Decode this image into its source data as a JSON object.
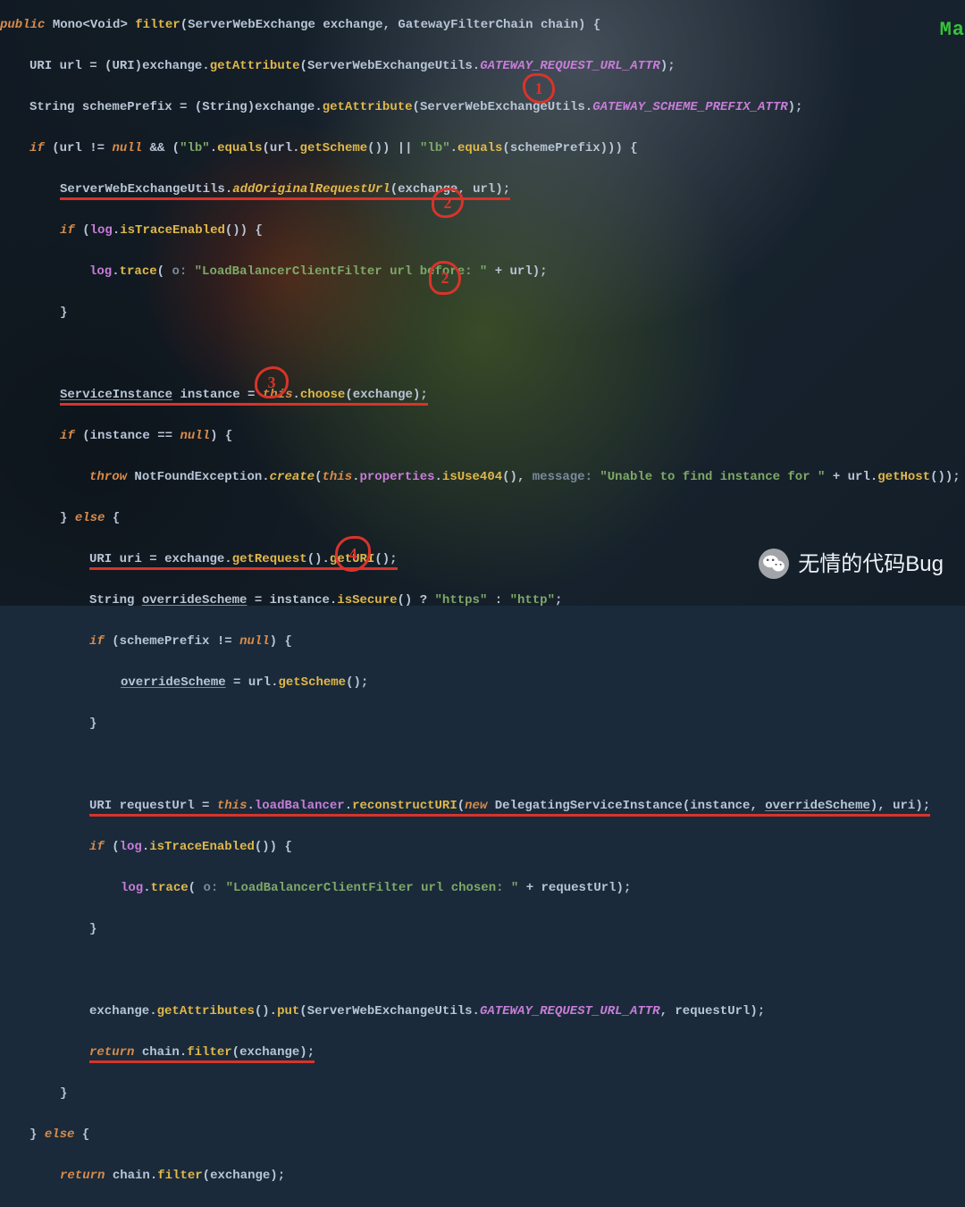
{
  "corner_label": "Ma",
  "watermark": "无情的代码Bug",
  "annotations": {
    "a1": "1",
    "a2": "2",
    "a2b": "2",
    "a3": "3",
    "a4": "4"
  },
  "tokens": {
    "public": "public",
    "Mono": "Mono",
    "Void": "Void",
    "filter": "filter",
    "ServerWebExchange": "ServerWebExchange",
    "exchange": "exchange",
    "GatewayFilterChain": "GatewayFilterChain",
    "chain": "chain",
    "URI": "URI",
    "url": "url",
    "getAttribute": "getAttribute",
    "ServerWebExchangeUtils": "ServerWebExchangeUtils",
    "GATEWAY_REQUEST_URL_ATTR": "GATEWAY_REQUEST_URL_ATTR",
    "String": "String",
    "schemePrefix": "schemePrefix",
    "GATEWAY_SCHEME_PREFIX_ATTR": "GATEWAY_SCHEME_PREFIX_ATTR",
    "if": "if",
    "null": "null",
    "lb": "\"lb\"",
    "equals": "equals",
    "getScheme": "getScheme",
    "addOriginalRequestUrl": "addOriginalRequestUrl",
    "log": "log",
    "isTraceEnabled": "isTraceEnabled",
    "trace": "trace",
    "o_hint": " o: ",
    "trace_before": "\"LoadBalancerClientFilter url before: \"",
    "ServiceInstance": "ServiceInstance",
    "instance": "instance",
    "this": "this",
    "choose": "choose",
    "throw": "throw",
    "NotFoundException": "NotFoundException",
    "create": "create",
    "properties": "properties",
    "isUse404": "isUse404",
    "message_hint": " message: ",
    "unable": "\"Unable to find instance for \"",
    "getHost": "getHost",
    "else": "else",
    "uri": "uri",
    "getRequest": "getRequest",
    "getURI": "getURI",
    "overrideScheme": "overrideScheme",
    "isSecure": "isSecure",
    "https": "\"https\"",
    "http": "\"http\"",
    "requestUrl": "requestUrl",
    "loadBalancer": "loadBalancer",
    "reconstructURI": "reconstructURI",
    "new": "new",
    "DelegatingServiceInstance": "DelegatingServiceInstance",
    "trace_chosen": "\"LoadBalancerClientFilter url chosen: \"",
    "getAttributes": "getAttributes",
    "put": "put",
    "return": "return"
  }
}
